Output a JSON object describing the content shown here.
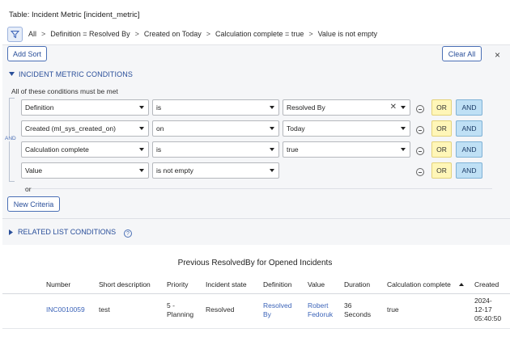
{
  "table_title": "Table: Incident Metric [incident_metric]",
  "breadcrumb": [
    "All",
    "Definition = Resolved By",
    "Created on Today",
    "Calculation complete = true",
    "Value is not empty"
  ],
  "buttons": {
    "add_sort": "Add Sort",
    "clear_all": "Clear All",
    "close": "×",
    "new_criteria": "New Criteria"
  },
  "conditions_section": {
    "title": "INCIDENT METRIC CONDITIONS",
    "subtitle": "All of these conditions must be met",
    "and_label": "AND",
    "or_text": "or"
  },
  "conditions": [
    {
      "field": "Definition",
      "operator": "is",
      "value": "Resolved By",
      "or": "OR",
      "and": "AND"
    },
    {
      "field": "Created (ml_sys_created_on)",
      "operator": "on",
      "value": "Today",
      "or": "OR",
      "and": "AND"
    },
    {
      "field": "Calculation complete",
      "operator": "is",
      "value": "true",
      "or": "OR",
      "and": "AND"
    },
    {
      "field": "Value",
      "operator": "is not empty",
      "value": "",
      "or": "OR",
      "and": "AND"
    }
  ],
  "related_section": {
    "title": "RELATED LIST CONDITIONS",
    "help": "?"
  },
  "report": {
    "title": "Previous ResolvedBy for Opened Incidents",
    "columns": [
      "Number",
      "Short description",
      "Priority",
      "Incident state",
      "Definition",
      "Value",
      "Duration",
      "Calculation complete",
      "Created"
    ],
    "row": {
      "number": "INC0010059",
      "short_description": "test",
      "priority": [
        "5 -",
        "Planning"
      ],
      "incident_state": "Resolved",
      "definition": [
        "Resolved",
        "By"
      ],
      "value": [
        "Robert",
        "Fedoruk"
      ],
      "duration": [
        "36",
        "Seconds"
      ],
      "calculation_complete": "true",
      "created": [
        "2024-",
        "12-17",
        "05:40:50"
      ]
    }
  },
  "colors": {
    "accent": "#2a4f9a",
    "or_bg": "#fff6b8",
    "and_bg": "#bfe0f5",
    "panel_bg": "#f5f6f8"
  }
}
